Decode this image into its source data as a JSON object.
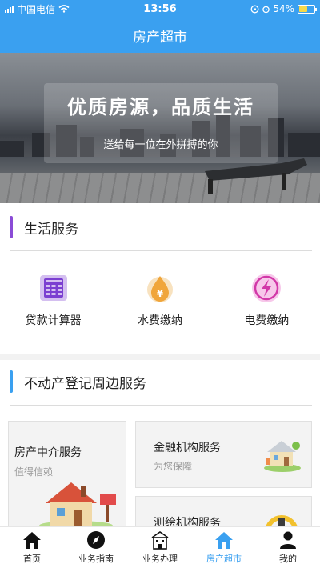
{
  "status_bar": {
    "carrier": "中国电信",
    "time": "13:56",
    "battery": "54%",
    "battery_level": 0.54
  },
  "header": {
    "title": "房产超市"
  },
  "banner": {
    "title": "优质房源，品质生活",
    "subtitle": "送给每一位在外拼搏的你"
  },
  "life_services": {
    "title": "生活服务",
    "accent": "#8a4bd6",
    "items": [
      {
        "label": "贷款计算器",
        "icon": "calculator-icon"
      },
      {
        "label": "水费缴纳",
        "icon": "water-drop-icon"
      },
      {
        "label": "电费缴纳",
        "icon": "lightning-icon"
      }
    ]
  },
  "property_services": {
    "title": "不动产登记周边服务",
    "accent": "#3aa0f0",
    "cards": [
      {
        "title": "房产中介服务",
        "subtitle": "值得信赖",
        "icon": "house-icon"
      },
      {
        "title": "金融机构服务",
        "subtitle": "为您保障",
        "icon": "villa-icon"
      },
      {
        "title": "测绘机构服务",
        "subtitle": "",
        "icon": "survey-icon"
      }
    ]
  },
  "tabbar": {
    "items": [
      {
        "label": "首页",
        "icon": "home-icon",
        "active": false
      },
      {
        "label": "业务指南",
        "icon": "compass-icon",
        "active": false
      },
      {
        "label": "业务办理",
        "icon": "office-building-icon",
        "active": false
      },
      {
        "label": "房产超市",
        "icon": "house-icon",
        "active": true
      },
      {
        "label": "我的",
        "icon": "user-icon",
        "active": false
      }
    ]
  },
  "colors": {
    "primary": "#3aa0f0",
    "background": "#ffffff"
  }
}
